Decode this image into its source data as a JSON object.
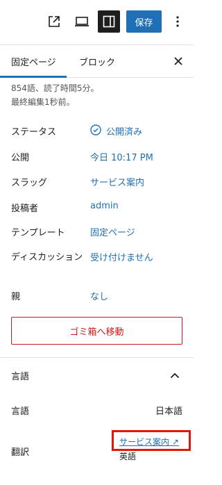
{
  "toolbar": {
    "save_label": "保存"
  },
  "tabs": {
    "page": "固定ページ",
    "block": "ブロック"
  },
  "meta": {
    "words": "854語、読了時間5分。",
    "edited": "最終編集1秒前。"
  },
  "summary": [
    {
      "label": "ステータス",
      "value": "公開済み"
    },
    {
      "label": "公開",
      "value": "今日 10:17 PM"
    },
    {
      "label": "スラッグ",
      "value": "サービス案内"
    },
    {
      "label": "投稿者",
      "value": "admin"
    },
    {
      "label": "テンプレート",
      "value": "固定ページ"
    },
    {
      "label": "ディスカッション",
      "value": "受け付けません"
    },
    {
      "label": "親",
      "value": "なし"
    }
  ],
  "trash_label": "ゴミ箱へ移動",
  "language_panel": {
    "title": "言語",
    "language_label": "言語",
    "language_value": "日本語",
    "translation_label": "翻訳",
    "translation_link": "サービス案内 ↗",
    "translation_lang": "英語"
  },
  "colors": {
    "accent": "#1e6fb3",
    "danger": "#cc1818",
    "highlight": "#e3160b"
  }
}
